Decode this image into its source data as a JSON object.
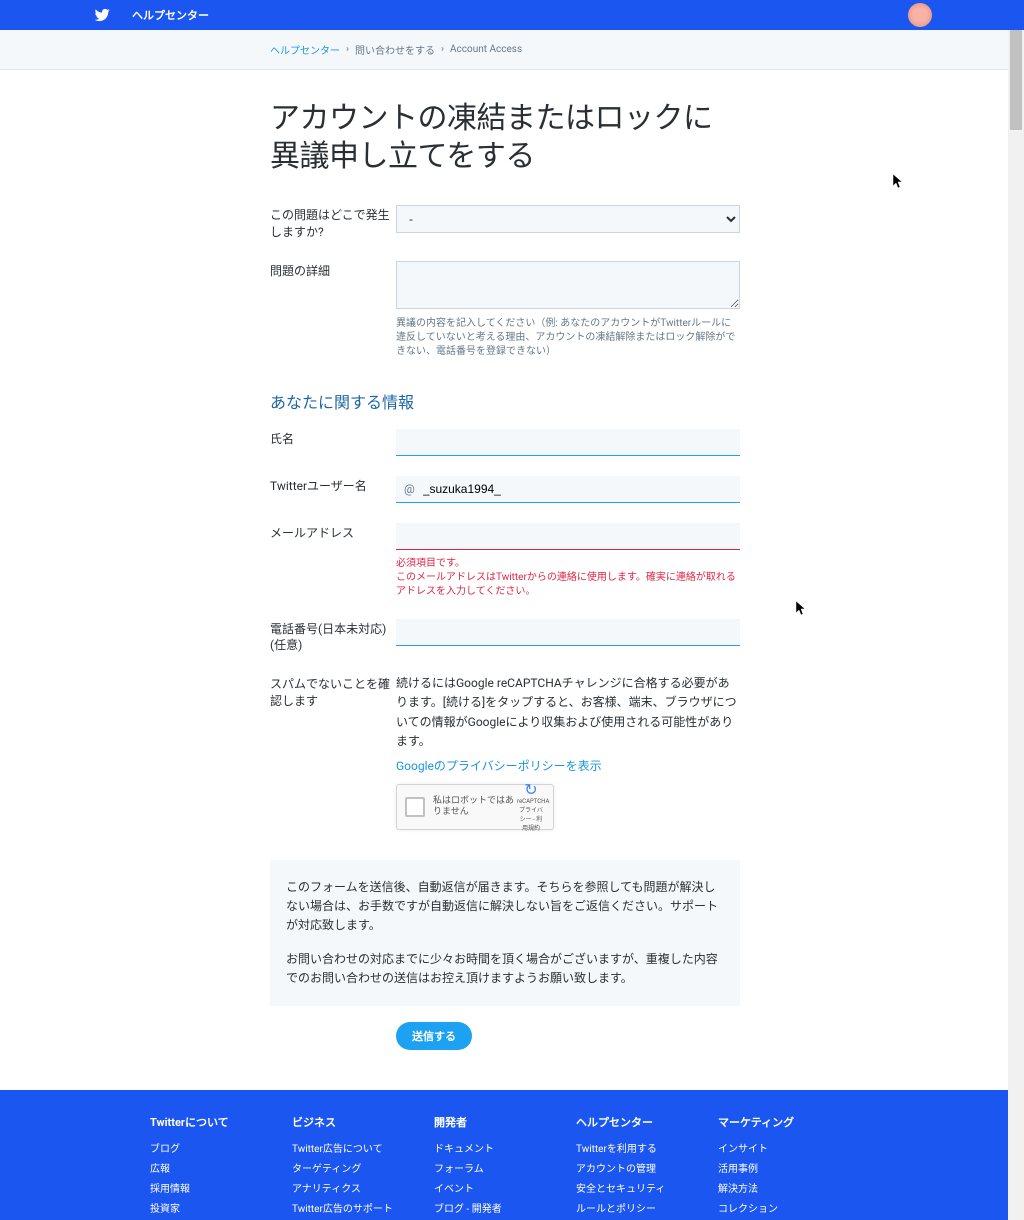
{
  "topbar": {
    "title": "ヘルプセンター"
  },
  "breadcrumbs": [
    {
      "label": "ヘルプセンター",
      "link": true
    },
    {
      "label": "問い合わせをする",
      "link": false
    },
    {
      "label": "Account Access",
      "link": false
    }
  ],
  "page_title": "アカウントの凍結またはロックに異議申し立てをする",
  "form": {
    "where_label": "この問題はどこで発生しますか?",
    "where_value": "-",
    "details_label": "問題の詳細",
    "details_help": "異議の内容を記入してください（例: あなたのアカウントがTwitterルールに違反していないと考える理由、アカウントの凍結解除またはロック解除ができない、電話番号を登録できない）",
    "section_heading": "あなたに関する情報",
    "name_label": "氏名",
    "username_label": "Twitterユーザー名",
    "username_prefix": "@",
    "username_value": "_suzuka1994_",
    "email_label": "メールアドレス",
    "email_error": "必須項目です。",
    "email_help": "このメールアドレスはTwitterからの連絡に使用します。確実に連絡が取れるアドレスを入力してください。",
    "phone_label": "電話番号(日本未対応) (任意)",
    "captcha_label": "スパムでないことを確認します",
    "captcha_text": "続けるにはGoogle reCAPTCHAチャレンジに合格する必要があります。[続ける]をタップすると、お客様、端末、ブラウザについての情報がGoogleにより収集および使用される可能性があります。",
    "captcha_link": "Googleのプライバシーポリシーを表示",
    "recaptcha_label": "私はロボットではありません",
    "recaptcha_brand": "reCAPTCHA",
    "recaptcha_sublink": "プライバシー - 利用規約"
  },
  "notice": {
    "p1": "このフォームを送信後、自動返信が届きます。そちらを参照しても問題が解決しない場合は、お手数ですが自動返信に解決しない旨をご返信ください。サポートが対応致します。",
    "p2": "お問い合わせの対応までに少々お時間を頂く場合がございますが、重複した内容でのお問い合わせの送信はお控え頂けますようお願い致します。"
  },
  "submit_label": "送信する",
  "footer": {
    "cols": [
      {
        "head": "Twitterについて",
        "links": [
          "ブログ",
          "広報",
          "採用情報",
          "投資家"
        ]
      },
      {
        "head": "ビジネス",
        "links": [
          "Twitter広告について",
          "ターゲティング",
          "アナリティクス",
          "Twitter広告のサポート"
        ]
      },
      {
        "head": "開発者",
        "links": [
          "ドキュメント",
          "フォーラム",
          "イベント",
          "ブログ - 開発者"
        ]
      },
      {
        "head": "ヘルプセンター",
        "links": [
          "Twitterを利用する",
          "アカウントの管理",
          "安全とセキュリティ",
          "ルールとポリシー"
        ]
      },
      {
        "head": "マーケティング",
        "links": [
          "インサイト",
          "活用事例",
          "解決方法",
          "コレクション"
        ]
      }
    ]
  }
}
